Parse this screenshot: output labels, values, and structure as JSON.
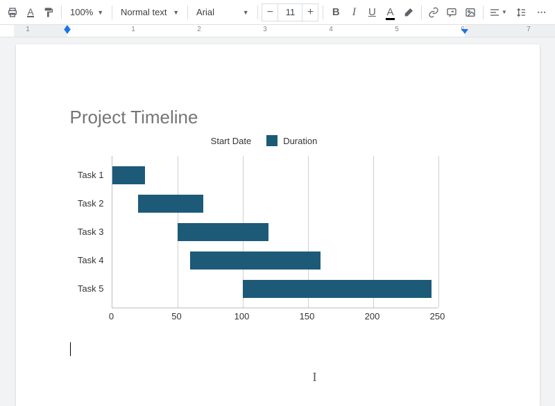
{
  "toolbar": {
    "zoom": "100%",
    "style": "Normal text",
    "font": "Arial",
    "font_size": "11"
  },
  "ruler": {
    "numbers": [
      "1",
      "1",
      "2",
      "3",
      "4",
      "5",
      "6",
      "7"
    ]
  },
  "chart_data": {
    "type": "bar",
    "orientation": "horizontal",
    "title": "Project Timeline",
    "legend": [
      "Start Date",
      "Duration"
    ],
    "categories": [
      "Task 1",
      "Task 2",
      "Task 3",
      "Task 4",
      "Task 5"
    ],
    "series": [
      {
        "name": "Start Date",
        "values": [
          0,
          20,
          50,
          60,
          100
        ],
        "color": "transparent"
      },
      {
        "name": "Duration",
        "values": [
          25,
          50,
          70,
          100,
          145
        ],
        "color": "#1c5a78"
      }
    ],
    "xticks": [
      0,
      50,
      100,
      150,
      200,
      250
    ],
    "xlim": [
      0,
      250
    ],
    "xlabel": "",
    "ylabel": ""
  }
}
